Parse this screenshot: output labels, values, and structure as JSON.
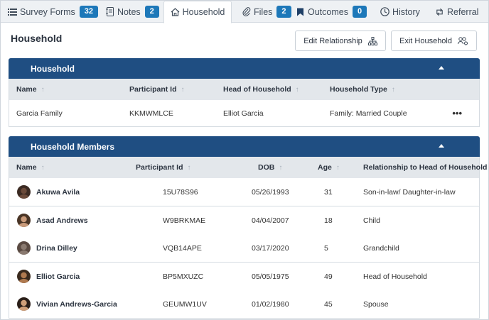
{
  "tabs": [
    {
      "label": "Survey Forms",
      "badge": "32",
      "icon": "list-icon"
    },
    {
      "label": "Notes",
      "badge": "2",
      "icon": "notebook-icon"
    },
    {
      "label": "Household",
      "badge": "",
      "icon": "home-icon"
    },
    {
      "label": "Files",
      "badge": "2",
      "icon": "paperclip-icon"
    },
    {
      "label": "Outcomes",
      "badge": "0",
      "icon": "bookmark-icon"
    },
    {
      "label": "History",
      "badge": "",
      "icon": "clock-icon"
    },
    {
      "label": "Referral",
      "badge": "",
      "icon": "retweet-icon"
    }
  ],
  "page_title": "Household",
  "buttons": {
    "edit_relationship": "Edit Relationship",
    "exit_household": "Exit Household"
  },
  "household_panel": {
    "title": "Household",
    "columns": [
      "Name",
      "Participant Id",
      "Head of Household",
      "Household Type"
    ],
    "row": {
      "name": "Garcia Family",
      "participant_id": "KKMWMLCE",
      "head": "Elliot Garcia",
      "type": "Family: Married Couple",
      "more": "•••"
    }
  },
  "members_panel": {
    "title": "Household Members",
    "columns": [
      "Name",
      "Participant Id",
      "DOB",
      "Age",
      "Relationship to Head of Household"
    ],
    "rows": [
      {
        "name": "Akuwa Avila",
        "participant_id": "15U78S96",
        "dob": "05/26/1993",
        "age": "31",
        "relationship": "Son-in-law/ Daughter-in-law"
      },
      {
        "name": "Asad Andrews",
        "participant_id": "W9BRKMAE",
        "dob": "04/04/2007",
        "age": "18",
        "relationship": "Child"
      },
      {
        "name": "Drina Dilley",
        "participant_id": "VQB14APE",
        "dob": "03/17/2020",
        "age": "5",
        "relationship": "Grandchild"
      },
      {
        "name": "Elliot Garcia",
        "participant_id": "BP5MXUZC",
        "dob": "05/05/1975",
        "age": "49",
        "relationship": "Head of Household"
      },
      {
        "name": "Vivian Andrews-Garcia",
        "participant_id": "GEUMW1UV",
        "dob": "01/02/1980",
        "age": "45",
        "relationship": "Spouse"
      }
    ]
  },
  "colors": {
    "accent": "#1d78b9",
    "panel_header": "#1f4e82",
    "table_header": "#e3e7eb"
  }
}
